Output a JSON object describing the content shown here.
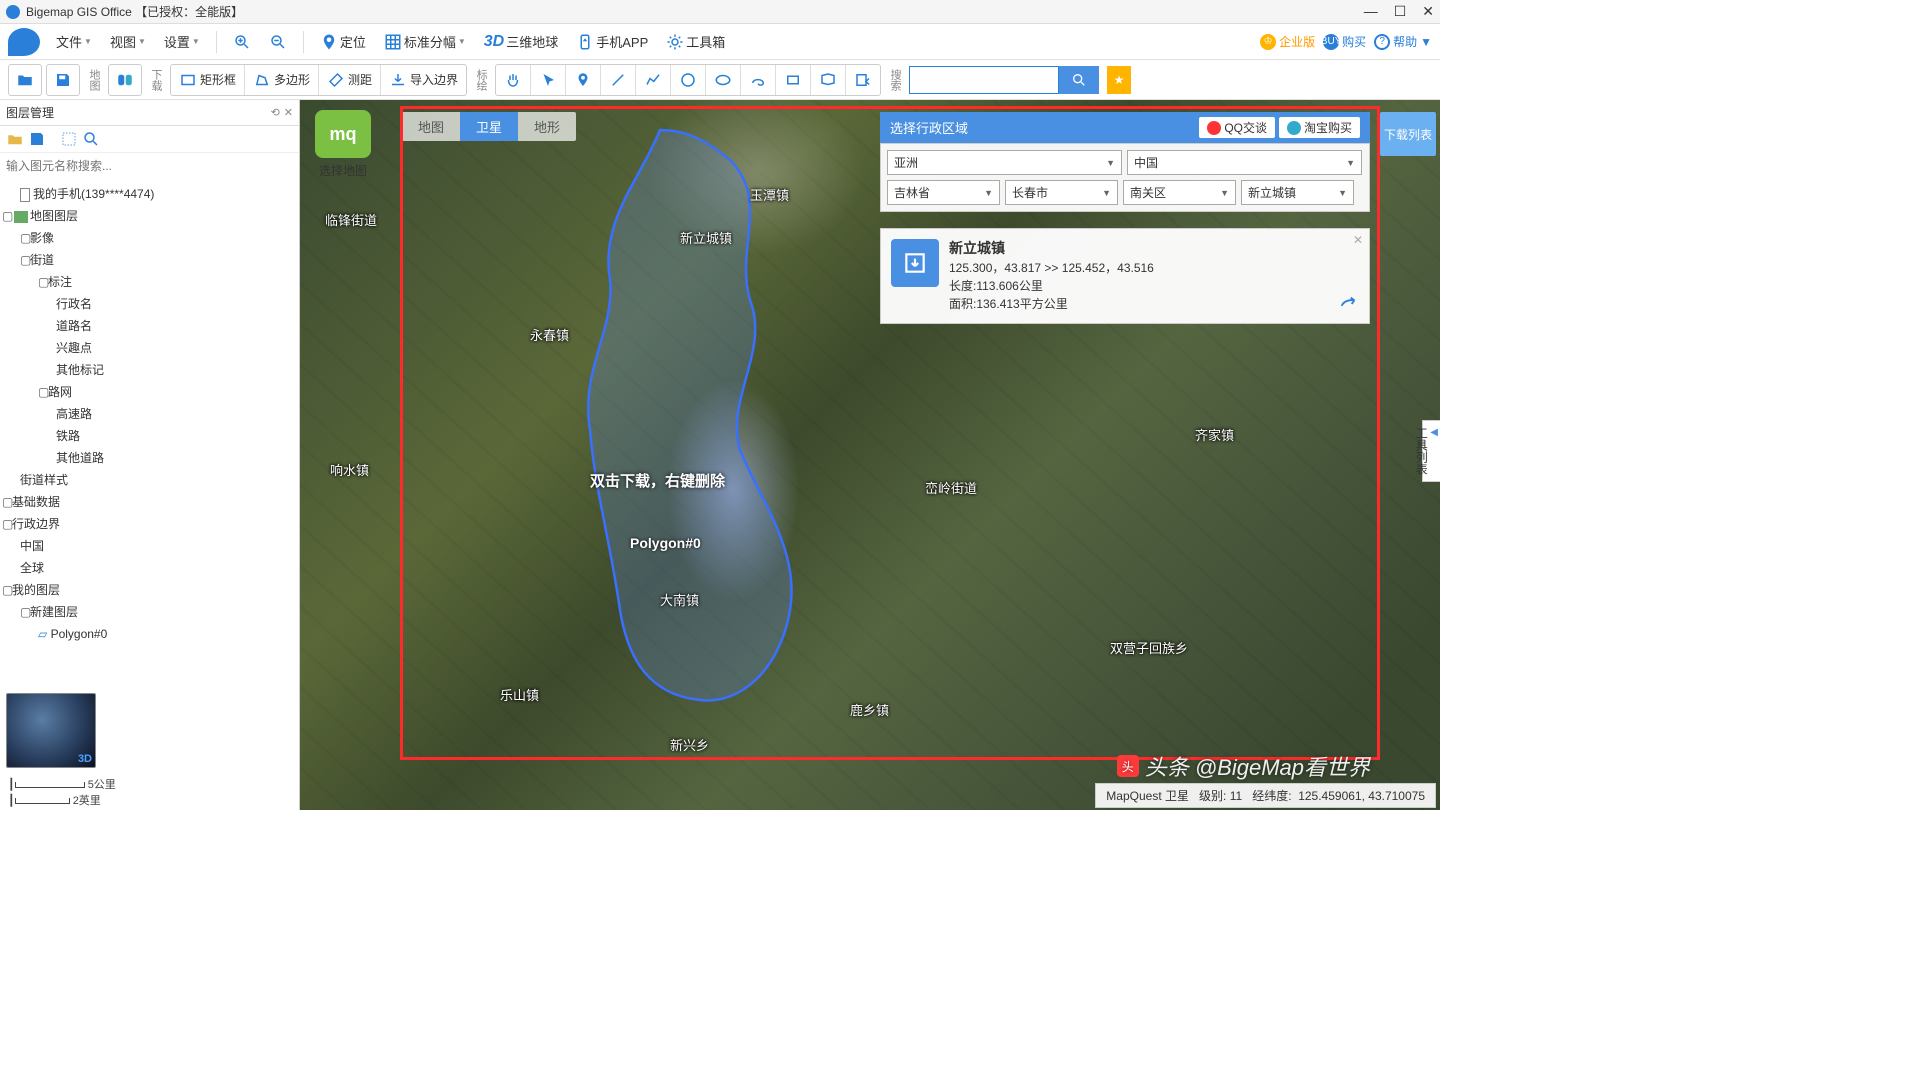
{
  "titlebar": {
    "title": "Bigemap GIS Office 【已授权：全能版】"
  },
  "menubar": {
    "file": "文件",
    "view": "视图",
    "settings": "设置",
    "locate": "定位",
    "grid": "标准分幅",
    "globe3d": "三维地球",
    "mobile": "手机APP",
    "toolbox": "工具箱",
    "enterprise": "企业版",
    "buy": "购买",
    "help": "帮助"
  },
  "toolbar2": {
    "vlabel_map": "地图",
    "vlabel_dl": "下载",
    "rect": "矩形框",
    "poly": "多边形",
    "measure": "测距",
    "import": "导入边界",
    "vlabel_annot": "标绘",
    "vlabel_search": "搜索"
  },
  "sidebar": {
    "title": "图层管理",
    "search_placeholder": "输入图元名称搜索...",
    "tree": {
      "phone": "我的手机(139****4474)",
      "maplayer": "地图图层",
      "image": "影像",
      "street": "街道",
      "annot": "标注",
      "admin_name": "行政名",
      "road_name": "道路名",
      "poi": "兴趣点",
      "other_mark": "其他标记",
      "network": "路网",
      "highway": "高速路",
      "railway": "铁路",
      "other_road": "其他道路",
      "street_style": "街道样式",
      "base_data": "基础数据",
      "admin_border": "行政边界",
      "china": "中国",
      "global": "全球",
      "my_layer": "我的图层",
      "new_layer": "新建图层",
      "polygon0": "Polygon#0"
    },
    "scale_km": "5公里",
    "scale_mi": "2英里"
  },
  "map": {
    "select_map": "选择地图",
    "tabs": {
      "map": "地图",
      "sat": "卫星",
      "terrain": "地形"
    },
    "region_header": "选择行政区域",
    "qq": "QQ交谈",
    "taobao": "淘宝购买",
    "sel_continent": "亚洲",
    "sel_country": "中国",
    "sel_province": "吉林省",
    "sel_city": "长春市",
    "sel_district": "南关区",
    "sel_town": "新立城镇",
    "info": {
      "name": "新立城镇",
      "coords": "125.300，43.817 >> 125.452，43.516",
      "length": "长度:113.606公里",
      "area": "面积:136.413平方公里"
    },
    "dl_list": "下载列表",
    "side_tab": "工具列表",
    "hint": "双击下载，右键删除",
    "poly_label": "Polygon#0",
    "labels": {
      "yushu": "玉潭镇",
      "xinli": "新立城镇",
      "yongchun": "永春镇",
      "xiangshui": "响水镇",
      "danan": "大南镇",
      "leshan": "乐山镇",
      "luxiang": "鹿乡镇",
      "xinxing": "新兴乡",
      "qijia": "齐家镇",
      "luanling": "峦岭街道",
      "shuangying": "双营子回族乡",
      "linfeng": "临锋街道"
    },
    "status": {
      "source": "MapQuest 卫星",
      "zoom_lbl": "级别:",
      "zoom": "11",
      "coord_lbl": "经纬度:",
      "coord": "125.459061, 43.710075"
    },
    "watermark": "头条 @BigeMap看世界"
  }
}
